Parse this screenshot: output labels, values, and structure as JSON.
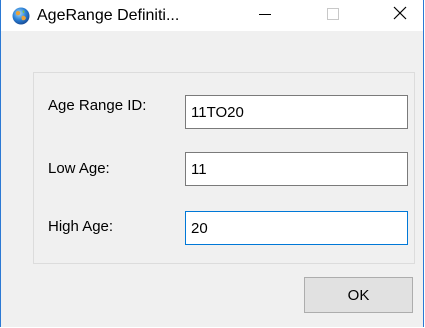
{
  "window": {
    "title": "AgeRange Definiti...",
    "icon": "globe-icon",
    "controls": {
      "minimize_icon": "minimize-icon",
      "maximize_icon": "maximize-icon",
      "close_icon": "close-icon"
    },
    "border_color": "#2b79d4"
  },
  "form": {
    "age_range_id": {
      "label": "Age Range ID:",
      "value": "11TO20"
    },
    "low_age": {
      "label": "Low Age:",
      "value": "11"
    },
    "high_age": {
      "label": "High Age:",
      "value": "20",
      "focused": true
    }
  },
  "buttons": {
    "ok_label": "OK"
  },
  "colors": {
    "focus_border": "#0078d7",
    "button_bg": "#e1e1e1",
    "dialog_bg": "#f0f0f0"
  }
}
